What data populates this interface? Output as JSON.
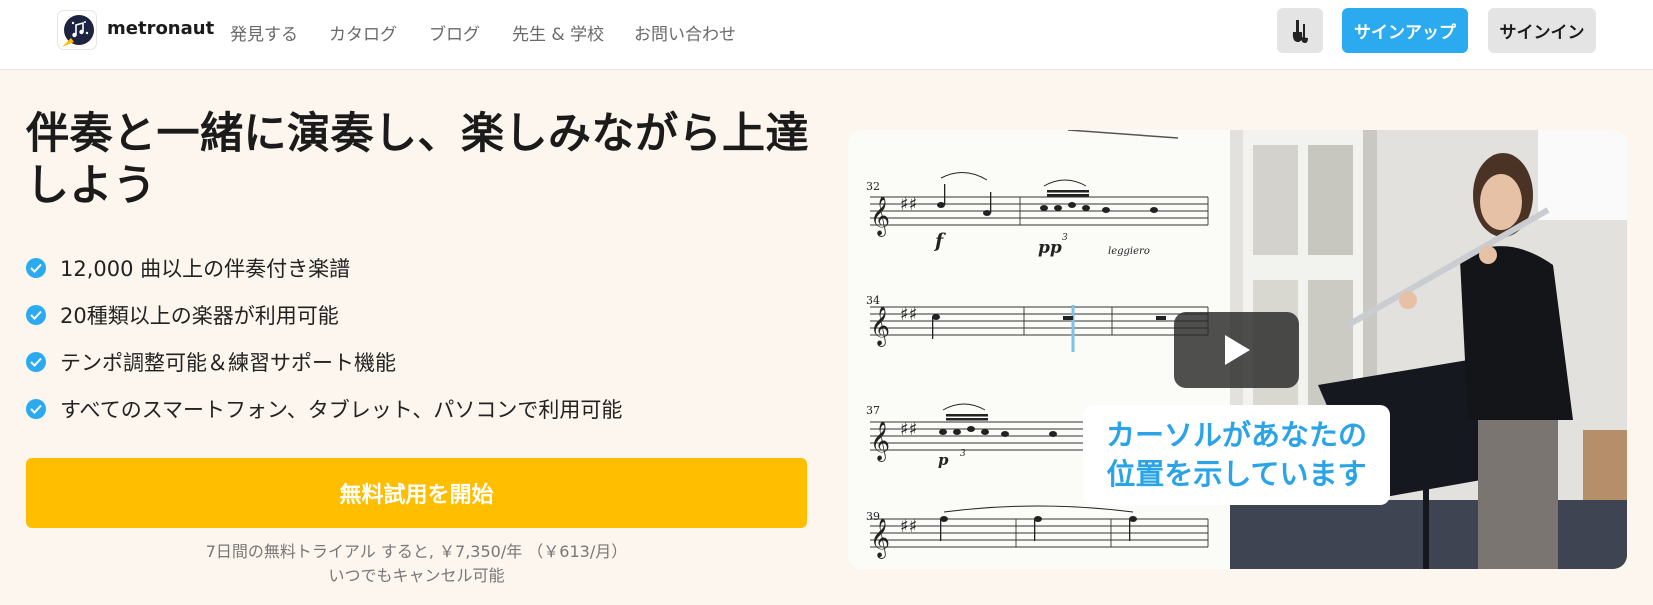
{
  "header": {
    "brand": "metronaut",
    "nav": [
      "発見する",
      "カタログ",
      "ブログ",
      "先生 & 学校",
      "お問い合わせ"
    ],
    "instrument_icon": "instrument-icon",
    "signup": "サインアップ",
    "signin": "サインイン"
  },
  "hero": {
    "title": "伴奏と一緒に演奏し、楽しみながら上達しよう",
    "features": [
      "12,000 曲以上の伴奏付き楽譜",
      "20種類以上の楽器が利用可能",
      "テンポ調整可能＆練習サポート機能",
      "すべてのスマートフォン、タブレット、パソコンで利用可能"
    ],
    "cta": "無料試用を開始",
    "trial_line": "7日間の無料トライアル すると, ￥7,350/年 （￥613/月）",
    "cancel_line": "いつでもキャンセル可能"
  },
  "video": {
    "caption_line1": "カーソルがあなたの",
    "caption_line2": "位置を示しています",
    "measures": [
      "32",
      "34",
      "37",
      "39"
    ],
    "dyn_f": "f",
    "dyn_pp": "pp",
    "dyn_p": "p",
    "tuplet": "3",
    "tuplet_b": "3",
    "leggiero": "leggiero"
  },
  "colors": {
    "accent": "#2baaf0",
    "cta": "#ffbe00",
    "hero_bg": "#fdf6ee"
  }
}
